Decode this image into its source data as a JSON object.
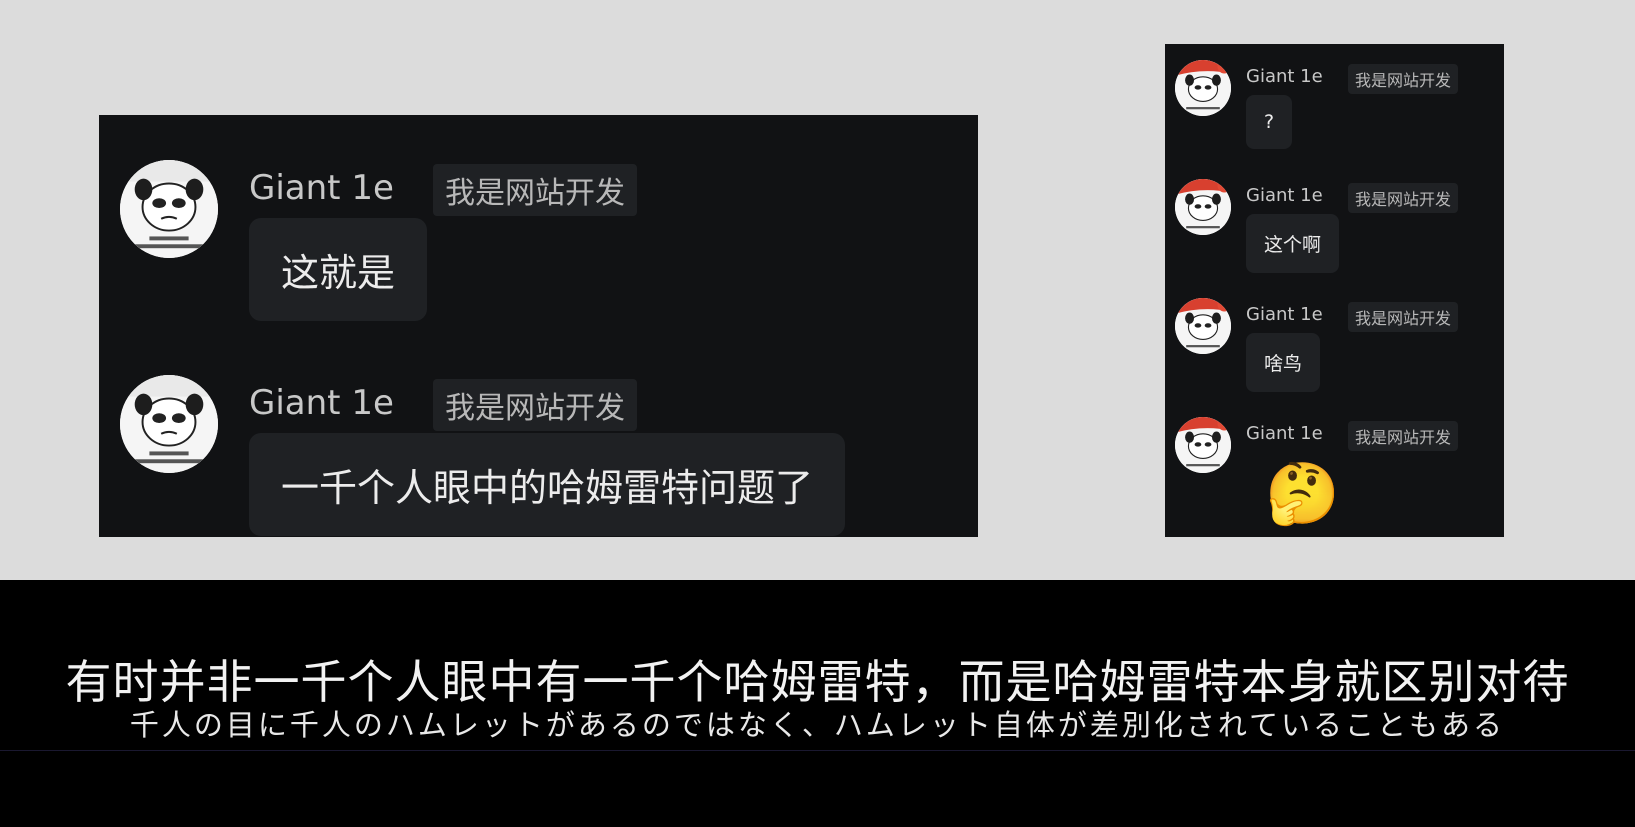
{
  "left_chat": {
    "messages": [
      {
        "author": "Giant 1e",
        "role_badge": "我是网站开发",
        "text": "这就是"
      },
      {
        "author": "Giant 1e",
        "role_badge": "我是网站开发",
        "text": "一千个人眼中的哈姆雷特问题了"
      }
    ]
  },
  "right_chat": {
    "messages": [
      {
        "author": "Giant 1e",
        "role_badge": "我是网站开发",
        "text": "?"
      },
      {
        "author": "Giant 1e",
        "role_badge": "我是网站开发",
        "text": "这个啊"
      },
      {
        "author": "Giant 1e",
        "role_badge": "我是网站开发",
        "text": "啥鸟"
      },
      {
        "author": "Giant 1e",
        "role_badge": "我是网站开发",
        "emoji": "🤔"
      }
    ]
  },
  "subtitles": {
    "chinese": "有时并非一千个人眼中有一千个哈姆雷特，而是哈姆雷特本身就区别对待",
    "japanese": "千人の目に千人のハムレットがあるのではなく、ハムレット自体が差別化されていることもある"
  },
  "icons": {
    "avatar": "panda-meme-avatar-icon",
    "thinking_emoji": "thinking-face-icon"
  },
  "colors": {
    "chat_background": "#111214",
    "bubble_background": "#1f2124",
    "page_background": "#dcdcdc",
    "subtitle_background": "#000000"
  }
}
